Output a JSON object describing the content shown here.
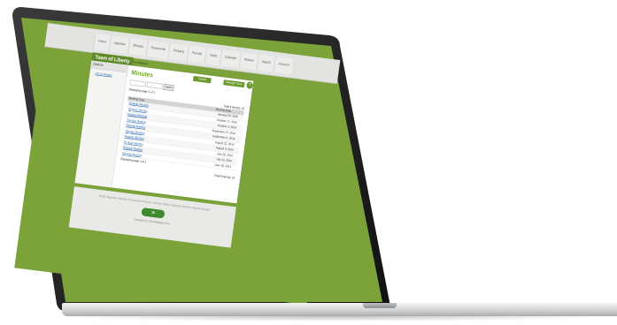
{
  "nav": {
    "items": [
      "Home",
      "Agendas",
      "Minutes",
      "Documents",
      "Property",
      "Permits",
      "Tasks",
      "Calendar",
      "Notices",
      "Search",
      "Account"
    ]
  },
  "site": {
    "title": "Town of Liberty"
  },
  "crumb": "Tom Balance",
  "page": {
    "heading": "Minutes",
    "logout_label": "Logout",
    "manage_label": "Manage Docs",
    "circle_label": "?"
  },
  "sidebar": {
    "options_label": "Options",
    "link_label": "List of minutes"
  },
  "search": {
    "placeholder_1": "",
    "placeholder_2": "",
    "button_label": "Search"
  },
  "table": {
    "displaying_top": "Displaying page 1 of 1",
    "total_top": "Total 6 item(s): 10",
    "col_type": "Meeting Type",
    "col_date": "Meeting Date",
    "rows": [
      {
        "name": "Regular Meeting",
        "date": "January 20, 2015"
      },
      {
        "name": "Regular Meeting",
        "date": "October 17, 2014"
      },
      {
        "name": "Regular Meeting",
        "date": "October 3, 2014"
      },
      {
        "name": "Regular Meeting",
        "date": "September 27, 2014"
      },
      {
        "name": "Regular Meeting",
        "date": "September 5, 2014"
      },
      {
        "name": "Regular Meeting",
        "date": "August 22, 2014"
      },
      {
        "name": "Regular Meeting",
        "date": "August 9, 2014"
      },
      {
        "name": "Regular Meeting",
        "date": "July 26, 2014"
      },
      {
        "name": "Regular Meeting",
        "date": "July 12, 2014"
      },
      {
        "name": "Regular Meeting",
        "date": "June 28, 2014"
      }
    ],
    "displaying_bot": "Displaying page 1 of 1",
    "total_bot": "Total 6 item(s): 10"
  },
  "footer": {
    "links": "Home | Agendas | Minutes | Documents | Property | Permits | Tasks | Calendar | Notices | Search | Account",
    "logo_text": "10",
    "copyright": "Copyright (c) 2014 Meetings 2014"
  }
}
